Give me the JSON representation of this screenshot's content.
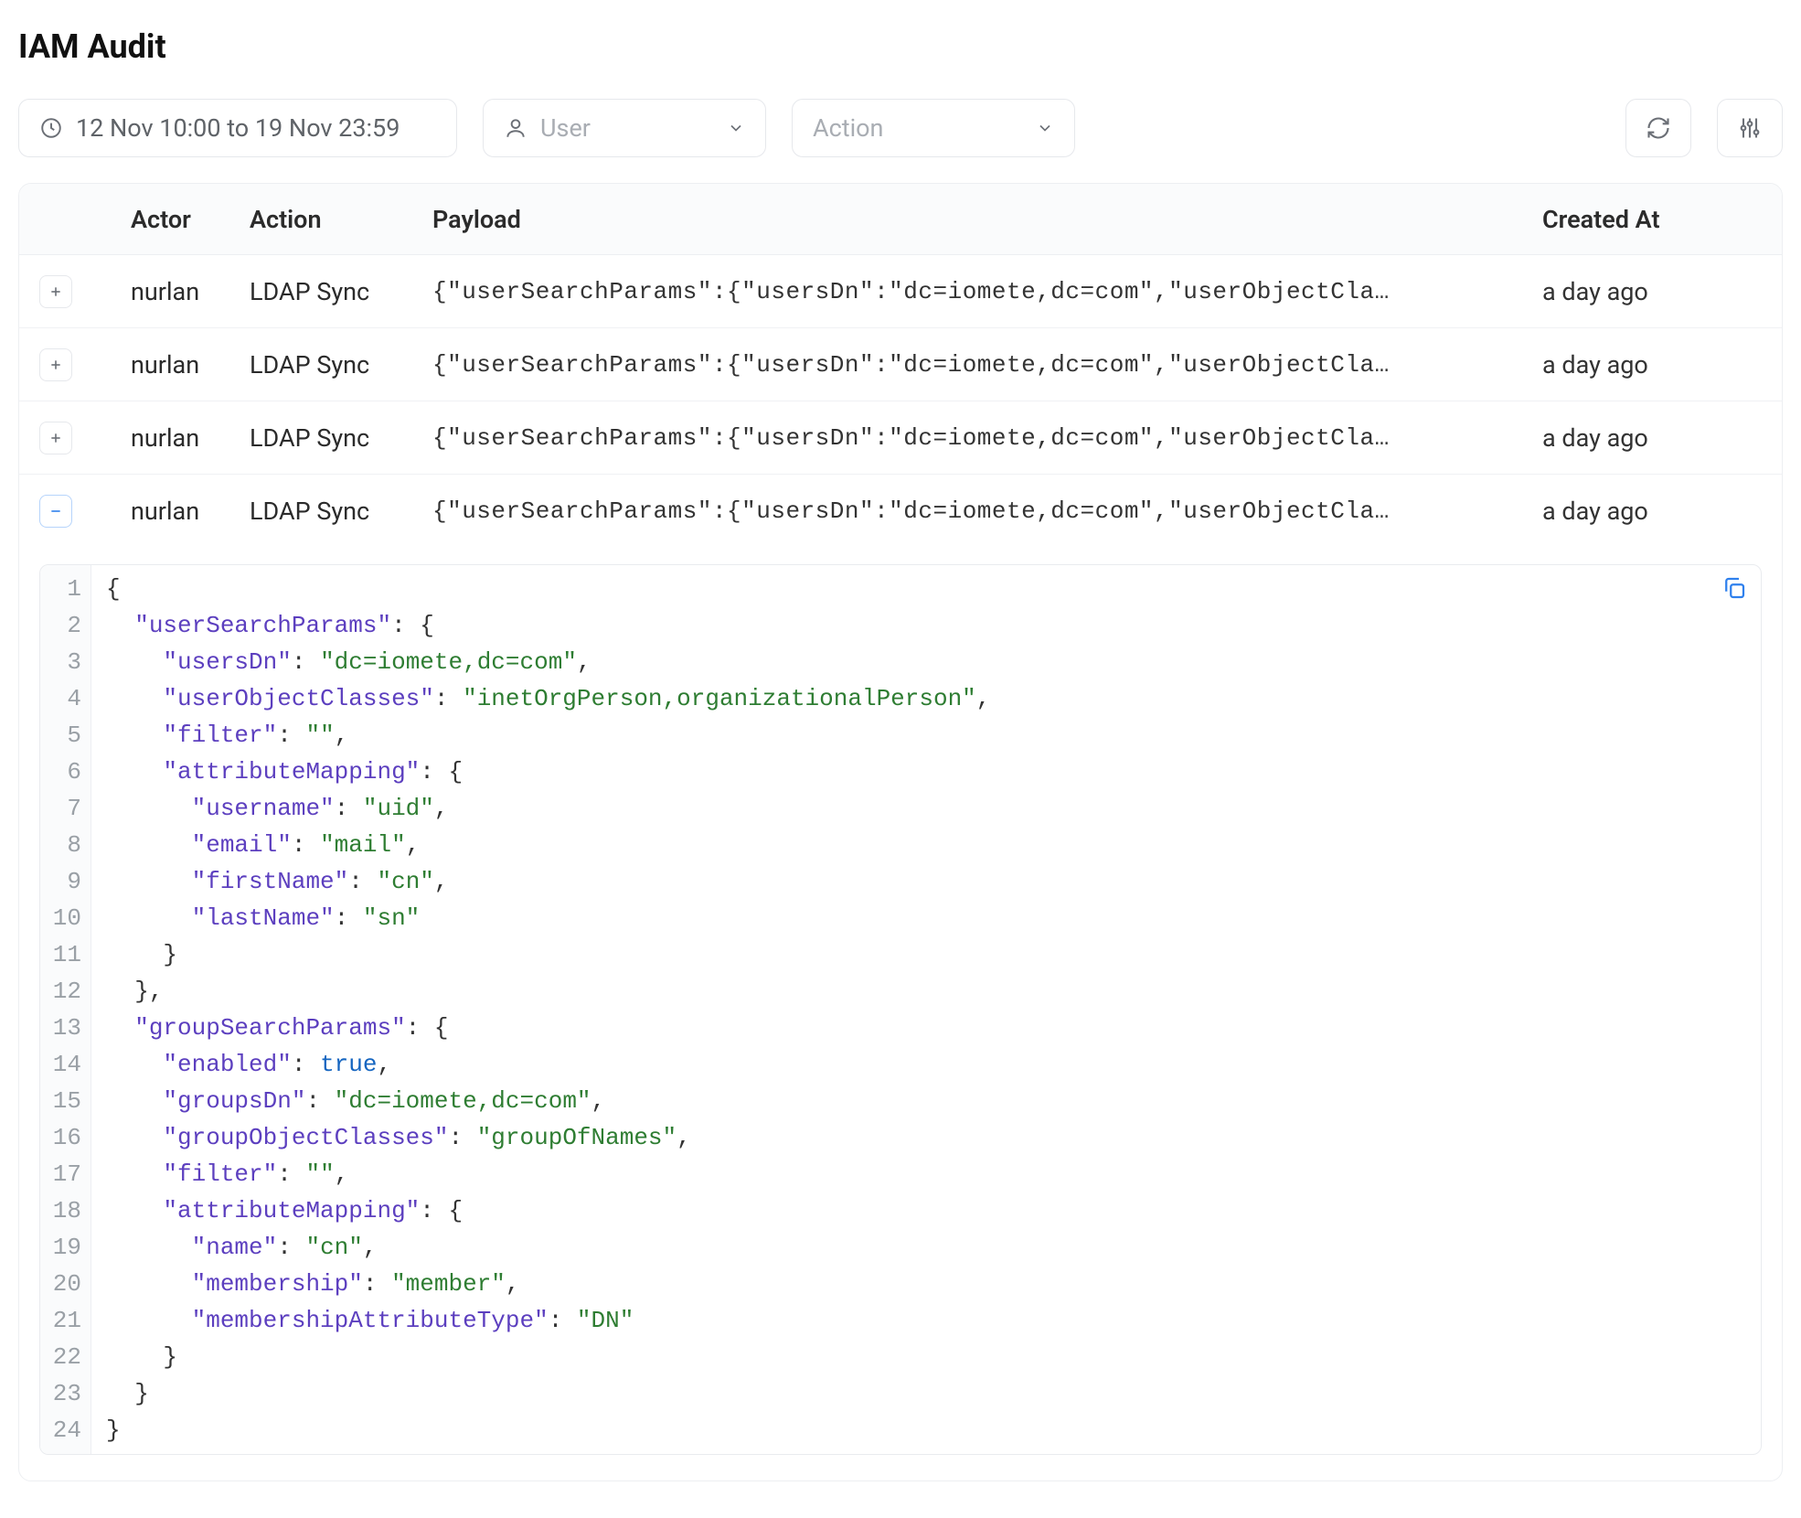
{
  "page": {
    "title": "IAM Audit"
  },
  "toolbar": {
    "date_range": "12 Nov 10:00 to 19 Nov 23:59",
    "user_placeholder": "User",
    "action_placeholder": "Action"
  },
  "table": {
    "columns": {
      "actor": "Actor",
      "action": "Action",
      "payload": "Payload",
      "created_at": "Created At"
    },
    "rows": [
      {
        "expanded": false,
        "actor": "nurlan",
        "action": "LDAP Sync",
        "payload_preview": "{\"userSearchParams\":{\"usersDn\":\"dc=iomete,dc=com\",\"userObjectCla…",
        "created_at": "a day ago"
      },
      {
        "expanded": false,
        "actor": "nurlan",
        "action": "LDAP Sync",
        "payload_preview": "{\"userSearchParams\":{\"usersDn\":\"dc=iomete,dc=com\",\"userObjectCla…",
        "created_at": "a day ago"
      },
      {
        "expanded": false,
        "actor": "nurlan",
        "action": "LDAP Sync",
        "payload_preview": "{\"userSearchParams\":{\"usersDn\":\"dc=iomete,dc=com\",\"userObjectCla…",
        "created_at": "a day ago"
      },
      {
        "expanded": true,
        "actor": "nurlan",
        "action": "LDAP Sync",
        "payload_preview": "{\"userSearchParams\":{\"usersDn\":\"dc=iomete,dc=com\",\"userObjectCla…",
        "created_at": "a day ago"
      }
    ]
  },
  "expanded_payload": {
    "userSearchParams": {
      "usersDn": "dc=iomete,dc=com",
      "userObjectClasses": "inetOrgPerson,organizationalPerson",
      "filter": "",
      "attributeMapping": {
        "username": "uid",
        "email": "mail",
        "firstName": "cn",
        "lastName": "sn"
      }
    },
    "groupSearchParams": {
      "enabled": true,
      "groupsDn": "dc=iomete,dc=com",
      "groupObjectClasses": "groupOfNames",
      "filter": "",
      "attributeMapping": {
        "name": "cn",
        "membership": "member",
        "membershipAttributeType": "DN"
      }
    }
  }
}
